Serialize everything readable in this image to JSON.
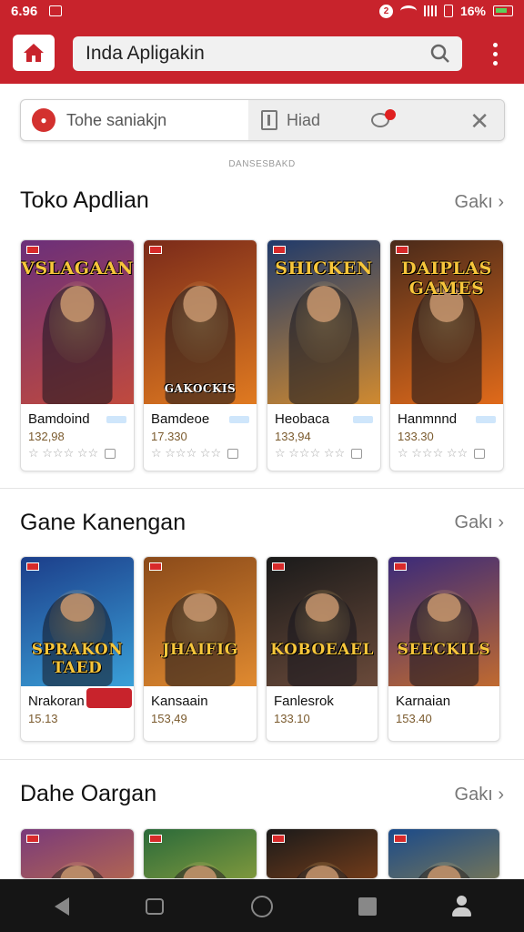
{
  "status_bar": {
    "time": "6.96",
    "notification_badge": "2",
    "battery_text": "16%"
  },
  "header": {
    "search_text": "Inda Apligakin",
    "icons": [
      "home-icon",
      "search-icon",
      "more-vertical-icon"
    ]
  },
  "filter_bar": {
    "left_label": "Tohe saniakjn",
    "right_label": "Hiad",
    "icons": [
      "red-badge-icon",
      "clipboard-icon",
      "chat-icon",
      "close-icon"
    ]
  },
  "sub_caption": "DANSESBAKD",
  "sections": [
    {
      "title": "Toko Apdlian",
      "more": "Gakı",
      "cards": [
        {
          "name": "Bamdoind",
          "price": "132,98",
          "meta": "☆ ☆☆☆ ☆☆",
          "art_title": "VSLAGAAN",
          "colors": [
            "#6b2f7a",
            "#c04a3e"
          ]
        },
        {
          "name": "Bamdeoe",
          "price": "17.330",
          "meta": "☆ ☆☆☆ ☆☆",
          "art_title": "GAKOCKIS",
          "colors": [
            "#7a2a1a",
            "#e07a20"
          ]
        },
        {
          "name": "Heobaca",
          "price": "133,94",
          "meta": "☆ ☆☆☆ ☆☆",
          "art_title": "SHICKEN",
          "colors": [
            "#1f3a6b",
            "#d08a30"
          ]
        },
        {
          "name": "Hanmnnd",
          "price": "133.30",
          "meta": "☆ ☆☆☆ ☆☆",
          "art_title": "DAIPLAS GAMES",
          "colors": [
            "#4a2a1a",
            "#e06a1a"
          ]
        }
      ]
    },
    {
      "title": "Gane Kanengan",
      "more": "Gakı",
      "cards": [
        {
          "name": "Nrakoran",
          "price": "15.13",
          "art_title": "SPRAKON TAED",
          "colors": [
            "#1c3e8a",
            "#3aa0d8"
          ]
        },
        {
          "name": "Kansaain",
          "price": "153,49",
          "art_title": "JHAIFIG",
          "colors": [
            "#8a4a1a",
            "#e08a30"
          ]
        },
        {
          "name": "Fanlesrok",
          "price": "133.10",
          "art_title": "KOBOEAEL",
          "colors": [
            "#1a1a1a",
            "#6a4a3a"
          ]
        },
        {
          "name": "Karnaian",
          "price": "153.40",
          "art_title": "SEECKILS",
          "colors": [
            "#3a2a7a",
            "#c06a30"
          ]
        }
      ]
    },
    {
      "title": "Dahe Oargan",
      "more": "Gakı",
      "cards": [
        {
          "colors": [
            "#7a3a7a",
            "#e08a30"
          ]
        },
        {
          "colors": [
            "#2a6a3a",
            "#c8c040"
          ]
        },
        {
          "colors": [
            "#1a1a1a",
            "#c05a1a"
          ]
        },
        {
          "colors": [
            "#1a4a8a",
            "#c09a30"
          ]
        }
      ]
    }
  ],
  "nav_bar": {
    "icons": [
      "back-icon",
      "chat-icon",
      "home-circle-icon",
      "recents-icon",
      "profile-icon"
    ]
  }
}
